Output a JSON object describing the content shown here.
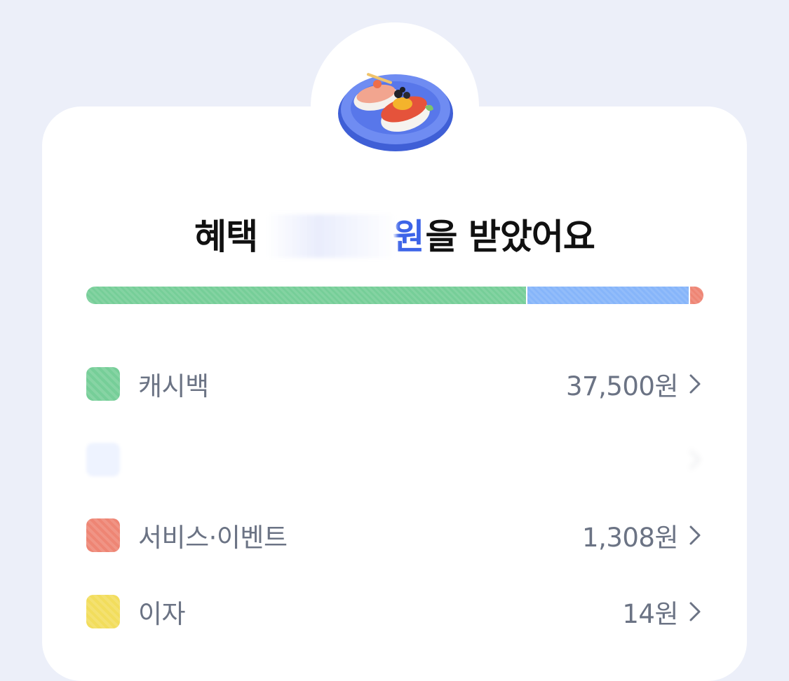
{
  "headline": {
    "prefix": "혜택 ",
    "amount": "원",
    "suffix": "을 받았어요"
  },
  "progress": {
    "segments": [
      {
        "name": "cashback",
        "share": 0.712,
        "color": "#76CE98"
      },
      {
        "name": "hidden",
        "share": 0.262,
        "color": "#86B5FA"
      },
      {
        "name": "service-event",
        "share": 0.026,
        "color": "#EE8574"
      }
    ]
  },
  "items": [
    {
      "label": "캐시백",
      "value": "37,500원",
      "color": "#76CE98",
      "icon": "chevron-right-icon"
    },
    {
      "label": "",
      "value": "",
      "color": "#EEF3FF",
      "icon": "chevron-right-icon"
    },
    {
      "label": "서비스·이벤트",
      "value": "1,308원",
      "color": "#EE8574",
      "icon": "chevron-right-icon"
    },
    {
      "label": "이자",
      "value": "14원",
      "color": "#F2DD5C",
      "icon": "chevron-right-icon"
    }
  ],
  "colors": {
    "background": "#ECEFF9",
    "card": "#FFFFFF",
    "accent": "#3D64E8",
    "text_primary": "#111111",
    "text_secondary": "#6B7384"
  }
}
